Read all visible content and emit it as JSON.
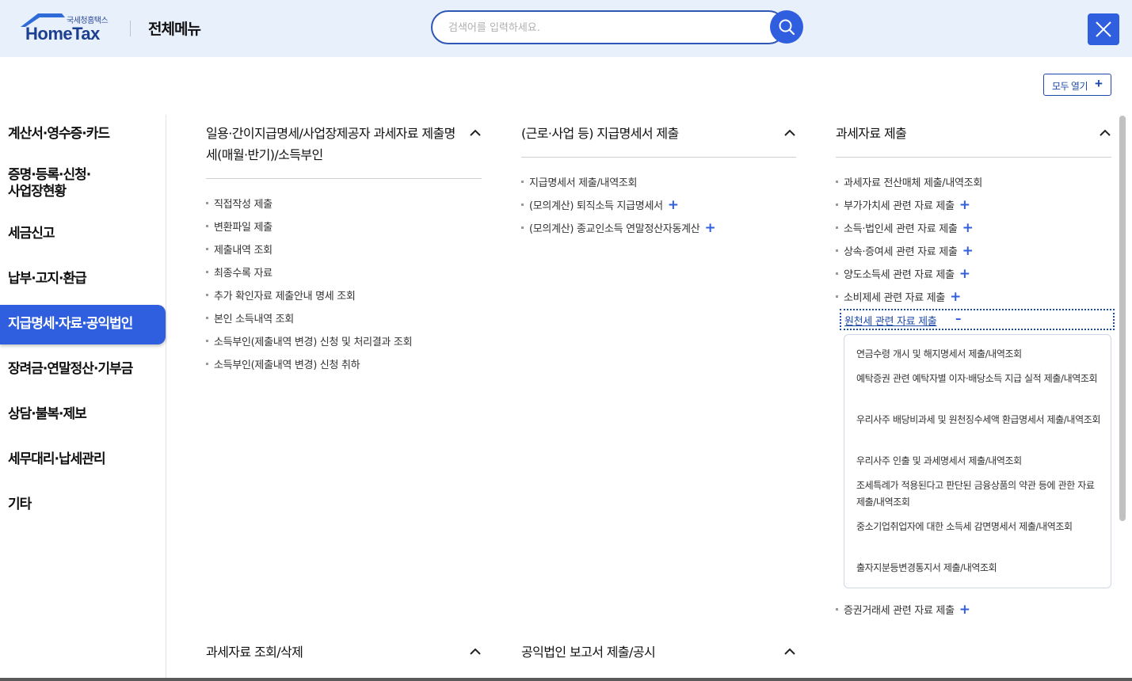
{
  "header": {
    "logo_sub": "국세청홈택스",
    "logo_main": "HomeTax",
    "title": "전체메뉴",
    "search_placeholder": "검색어를 입력하세요."
  },
  "toolbar": {
    "expand_all": "모두 열기",
    "plus": "+"
  },
  "sidebar": {
    "items": [
      "계산서·영수증·카드",
      "증명·등록·신청·\n사업장현황",
      "세금신고",
      "납부·고지·환급",
      "지급명세·자료·공익법인",
      "장려금·연말정산·기부금",
      "상담·불복·제보",
      "세무대리·납세관리",
      "기타"
    ],
    "active_index": 4
  },
  "col1": {
    "title": "일용·간이지급명세/사업장제공자 과세자료 제출명세(매월·반기)/소득부인",
    "items": [
      "직접작성 제출",
      "변환파일 제출",
      "제출내역 조회",
      "최종수록 자료",
      "추가 확인자료 제출안내 명세 조회",
      "본인 소득내역 조회",
      "소득부인(제출내역 변경) 신청 및 처리결과 조회",
      "소득부인(제출내역 변경) 신청 취하"
    ]
  },
  "col2": {
    "title": "(근로·사업 등) 지급명세서 제출",
    "items": [
      "지급명세서 제출/내역조회",
      "(모의계산) 퇴직소득 지급명세서",
      "(모의계산) 종교인소득 연말정산자동계산"
    ]
  },
  "col3": {
    "title": "과세자료 제출",
    "items": [
      "과세자료 전산매체 제출/내역조회",
      "부가가치세 관련 자료 제출",
      "소득·법인세 관련 자료 제출",
      "상속·증여세 관련 자료 제출",
      "양도소득세 관련 자료 제출",
      "소비제세 관련 자료 제출"
    ],
    "expanded_item": "원천세 관련 자료 제출",
    "sub_items": [
      "연금수령 개시 및 해지명세서 제출/내역조회",
      "예탁증권 관련 예탁자별 이자·배당소득 지급 실적 제출/내역조회",
      "우리사주 배당비과세 및 원천징수세액 환급명세서 제출/내역조회",
      "우리사주 인출 및 과세명세서 제출/내역조회",
      "조세특례가 적용된다고 판단된 금융상품의 약관 등에 관한 자료 제출/내역조회",
      "중소기업취업자에 대한 소득세 감면명세서 제출/내역조회",
      "출자지분등변경통지서 제출/내역조회"
    ],
    "last_item": "증권거래세 관련 자료 제출"
  },
  "bottom": {
    "col1_title": "과세자료 조회/삭제",
    "col2_title": "공익법인 보고서 제출/공시"
  },
  "icons": {
    "plus": "+",
    "minus": "–"
  },
  "colors": {
    "accent": "#2f5fdf",
    "header_bg": "#e8f0fb",
    "brand": "#1d3f8f"
  }
}
